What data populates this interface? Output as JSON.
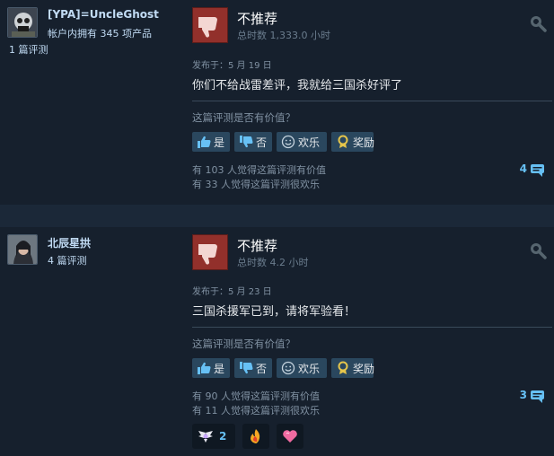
{
  "reviews": [
    {
      "author": {
        "name": "[YPA]=UncleGhost",
        "products": "帐户内拥有 345 项产品",
        "reviews": "1 篇评测"
      },
      "verdict": "不推荐",
      "hours": "总时数 1,333.0 小时",
      "posted": "发布于：5 月 19 日",
      "content": "你们不给战雷差评，我就给三国杀好评了",
      "question": "这篇评测是否有价值？",
      "buttons": {
        "yes": "是",
        "no": "否",
        "funny": "欢乐",
        "award": "奖励"
      },
      "stats": {
        "helpful": "有 103 人觉得这篇评测有价值",
        "funny": "有 33 人觉得这篇评测很欢乐"
      },
      "comment_count": "4"
    },
    {
      "author": {
        "name": "北辰星拱",
        "reviews": "4 篇评测"
      },
      "verdict": "不推荐",
      "hours": "总时数 4.2 小时",
      "posted": "发布于：5 月 23 日",
      "content": "三国杀援军已到，请将军验看！",
      "question": "这篇评测是否有价值？",
      "buttons": {
        "yes": "是",
        "no": "否",
        "funny": "欢乐",
        "award": "奖励"
      },
      "stats": {
        "helpful": "有 90 人觉得这篇评测有价值",
        "funny": "有 11 人觉得这篇评测很欢乐"
      },
      "comment_count": "3",
      "awards": [
        {
          "icon": "winged-award-icon",
          "count": "2"
        },
        {
          "icon": "fire-award-icon",
          "count": ""
        },
        {
          "icon": "heart-award-icon",
          "count": ""
        }
      ]
    }
  ],
  "colors": {
    "thumb_down_bg": "#92302b",
    "link_blue": "#66c0f4",
    "button_bg": "#2a475e"
  }
}
